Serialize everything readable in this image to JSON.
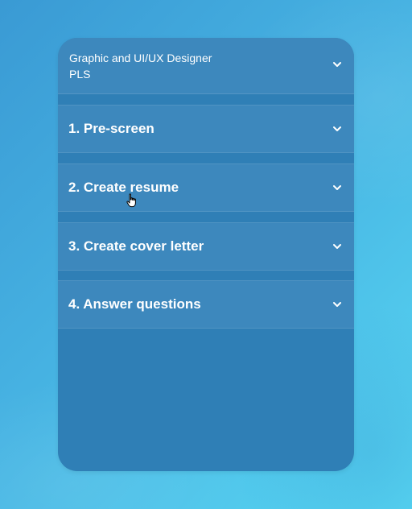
{
  "job": {
    "title": "Graphic and UI/UX Designer",
    "company": "PLS",
    "expand_icon": "chevron-down-icon"
  },
  "steps": [
    {
      "label": "1. Pre-screen",
      "icon": "chevron-down-icon"
    },
    {
      "label": "2. Create resume",
      "icon": "chevron-down-icon"
    },
    {
      "label": "3. Create cover letter",
      "icon": "chevron-down-icon"
    },
    {
      "label": "4. Answer questions",
      "icon": "chevron-down-icon"
    }
  ],
  "colors": {
    "panel": "#2f7fb6",
    "row": "#3d88bd",
    "text": "#ffffff"
  },
  "cursor": "hand-pointer-icon"
}
